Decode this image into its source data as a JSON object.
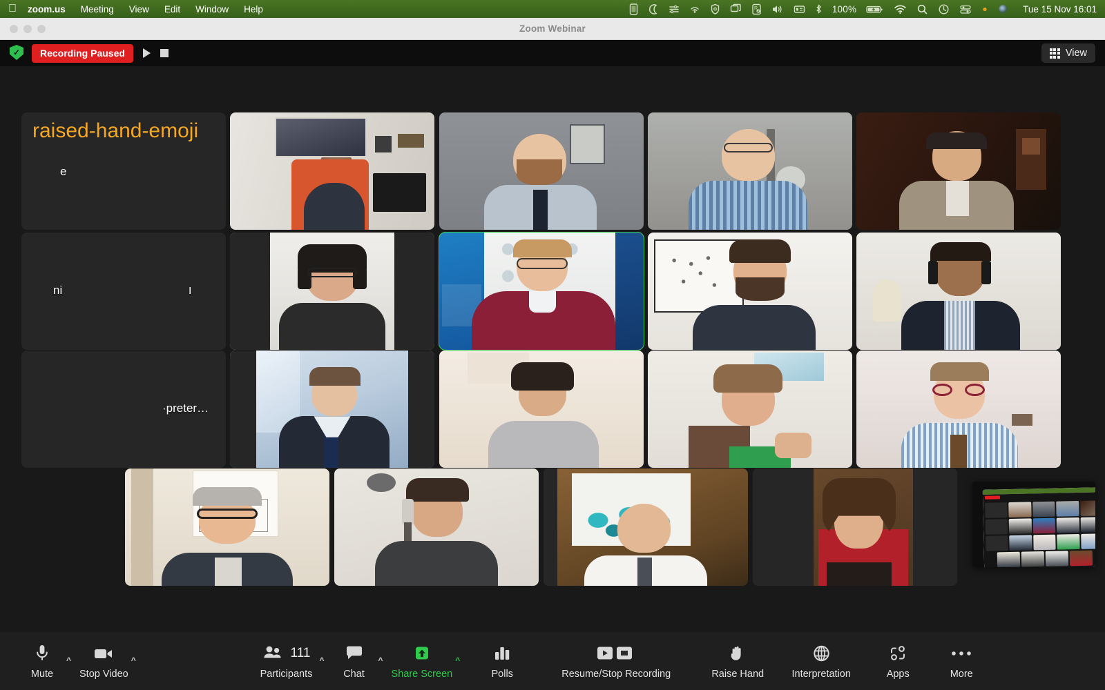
{
  "menubar": {
    "apple_glyph": "",
    "items": [
      {
        "label": "zoom.us",
        "bold": true
      },
      {
        "label": "Meeting",
        "bold": false
      },
      {
        "label": "View",
        "bold": false
      },
      {
        "label": "Edit",
        "bold": false
      },
      {
        "label": "Window",
        "bold": false
      },
      {
        "label": "Help",
        "bold": false
      }
    ],
    "status_icons": [
      "mobile-device-icon",
      "moon-do-not-disturb-icon",
      "vpn-icon",
      "airplay-icon",
      "shield-privacy-icon",
      "display-mirror-icon",
      "screen-record-icon",
      "volume-icon",
      "keyboard-input-icon",
      "bluetooth-icon"
    ],
    "battery_percent": "100%",
    "battery_icon": "battery-charging-icon",
    "right_icons": [
      "wifi-icon",
      "search-icon",
      "control-center-icon",
      "siri-icon"
    ],
    "clock": "Tue 15 Nov  16:01",
    "bar_color": "#44701f"
  },
  "window": {
    "title": "Zoom Webinar",
    "traffic_lights": [
      "close-button",
      "minimize-button",
      "zoom-button"
    ],
    "titlebar_color": "#e9e9e9"
  },
  "zoom_top_bar": {
    "shield_icon": "encryption-shield-icon",
    "recording_badge": "Recording Paused",
    "recording_badge_color": "#e02020",
    "resume_icon": "play-icon",
    "stop_icon": "stop-icon",
    "view_button": {
      "label": "View",
      "icon": "grid-view-icon"
    }
  },
  "gallery": {
    "active_speaker_border_color": "#2ecc4a",
    "background_color": "#191919",
    "tiles": [
      {
        "id": 1,
        "name": "e",
        "name_align": "left",
        "video_off": true,
        "hand_raised": true,
        "hand_icon": "raised-hand-emoji",
        "active": false
      },
      {
        "id": 2,
        "name": "",
        "video_off": false,
        "active": false,
        "scene": "man-in-orange-chair-london-poster"
      },
      {
        "id": 3,
        "name": "",
        "video_off": false,
        "active": false,
        "scene": "bearded-man-grey-wall-tie"
      },
      {
        "id": 4,
        "name": "",
        "video_off": false,
        "active": false,
        "scene": "man-glasses-blue-check-shirt"
      },
      {
        "id": 5,
        "name": "",
        "video_off": false,
        "active": false,
        "scene": "man-headphones-dark-room"
      },
      {
        "id": 6,
        "name": "ni",
        "name2": "ו",
        "video_off": true,
        "active": false
      },
      {
        "id": 7,
        "name": "",
        "video_off": false,
        "active": false,
        "scene": "woman-headset-glasses-white-wall"
      },
      {
        "id": 8,
        "name": "",
        "video_off": false,
        "active": true,
        "scene": "man-red-sweater-eu-aml-cft-banner"
      },
      {
        "id": 9,
        "name": "",
        "video_off": false,
        "active": false,
        "scene": "bearded-man-world-map-poster"
      },
      {
        "id": 10,
        "name": "",
        "video_off": false,
        "active": false,
        "scene": "man-headset-striped-shirt"
      },
      {
        "id": 11,
        "name": "",
        "name2": "·preter…",
        "video_off": true,
        "active": false
      },
      {
        "id": 12,
        "name": "",
        "video_off": false,
        "active": false,
        "scene": "man-suit-window-light"
      },
      {
        "id": 13,
        "name": "",
        "video_off": false,
        "active": false,
        "scene": "woman-short-hair-grey-top"
      },
      {
        "id": 14,
        "name": "",
        "video_off": false,
        "active": false,
        "scene": "woman-green-top-earphones"
      },
      {
        "id": 15,
        "name": "",
        "video_off": false,
        "active": false,
        "scene": "man-red-glasses-check-shirt"
      },
      {
        "id": 16,
        "name": "",
        "video_off": false,
        "active": false,
        "scene": "man-glasses-flipchart-smiling"
      },
      {
        "id": 17,
        "name": "",
        "video_off": false,
        "active": false,
        "scene": "man-headset-bright-wall"
      },
      {
        "id": 18,
        "name": "",
        "video_off": false,
        "active": false,
        "scene": "bald-man-white-shirt-blue-artwork"
      },
      {
        "id": 19,
        "name": "",
        "video_off": false,
        "active": false,
        "scene": "woman-long-hair-red-background"
      }
    ]
  },
  "pip": {
    "label": "picture-in-picture-preview",
    "recording_badge_color": "#e02020"
  },
  "toolbar": {
    "background_color": "#1f1f1f",
    "accent_color": "#2ecc4a",
    "items": [
      {
        "key": "mute",
        "label": "Mute",
        "icon": "microphone-icon",
        "caret": true,
        "green": false
      },
      {
        "key": "video",
        "label": "Stop Video",
        "icon": "camera-icon",
        "caret": true,
        "green": false
      },
      {
        "key": "participants",
        "label": "Participants",
        "icon": "people-icon",
        "count": "111",
        "caret": true,
        "green": false
      },
      {
        "key": "chat",
        "label": "Chat",
        "icon": "chat-bubble-icon",
        "caret": true,
        "green": false
      },
      {
        "key": "share",
        "label": "Share Screen",
        "icon": "share-up-arrow-icon",
        "caret": true,
        "green": true
      },
      {
        "key": "polls",
        "label": "Polls",
        "icon": "bar-chart-icon",
        "caret": false,
        "green": false
      },
      {
        "key": "recording",
        "label": "Resume/Stop Recording",
        "icon": "play-stop-icon",
        "caret": false,
        "green": false
      },
      {
        "key": "raisehand",
        "label": "Raise Hand",
        "icon": "hand-icon",
        "caret": false,
        "green": false
      },
      {
        "key": "interpretation",
        "label": "Interpretation",
        "icon": "globe-icon",
        "caret": false,
        "green": false
      },
      {
        "key": "apps",
        "label": "Apps",
        "icon": "apps-icon",
        "caret": false,
        "green": false
      },
      {
        "key": "more",
        "label": "More",
        "icon": "ellipsis-icon",
        "caret": false,
        "green": false
      }
    ]
  }
}
